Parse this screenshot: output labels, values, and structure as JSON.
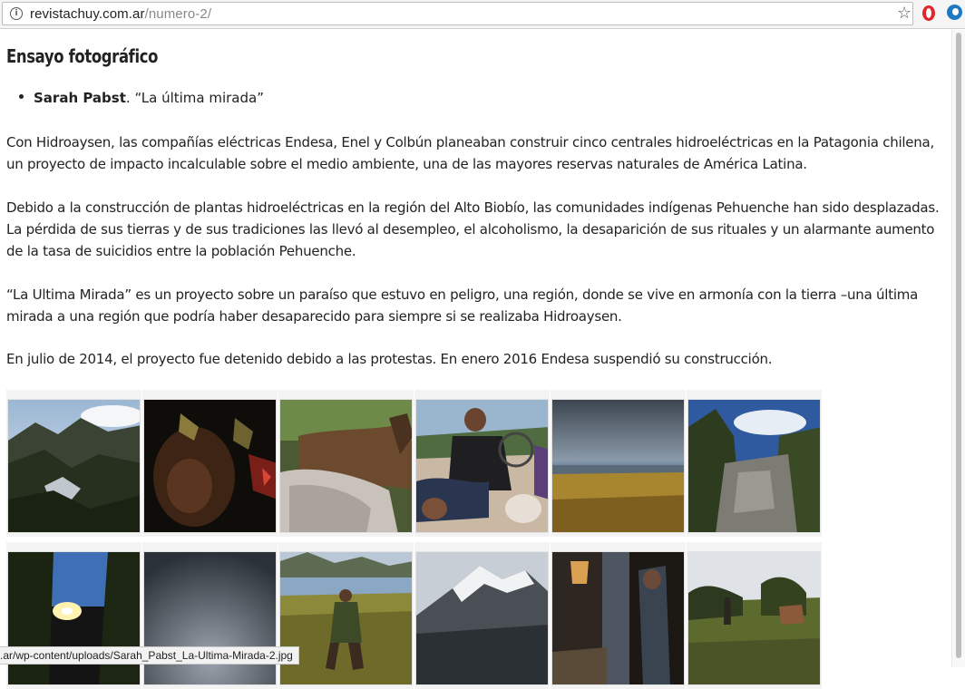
{
  "browser": {
    "url_domain": "revistachuy.com.ar",
    "url_path": "/numero-2/",
    "status_url": ".ar/wp-content/uploads/Sarah_Pabst_La-Ultima-Mirada-2.jpg"
  },
  "article": {
    "heading": "Ensayo fotográfico",
    "bullet_author": "Sarah Pabst",
    "bullet_title": ". “La última mirada”",
    "paragraphs": [
      "Con Hidroaysen, las compañías eléctricas Endesa, Enel y Colbún planeaban construir cinco centrales hidroeléctricas en la Patagonia chilena, un proyecto de impacto incalculable sobre el medio ambiente, una de las mayores reservas naturales de América Latina.",
      "Debido a la construcción de plantas hidroeléctricas en la región del Alto Biobío, las comunidades indígenas Pehuenche han sido desplazadas. La pérdida de sus tierras y de sus tradiciones las llevó al desempleo, el alcoholismo, la desaparición de sus rituales y un alarmante aumento de la tasa de suicidios entre la población Pehuenche.",
      "“La Ultima Mirada” es un proyecto sobre un paraíso que estuvo en peligro, una región, donde se vive en armonía con la tierra –una última mirada a una región que podría haber desaparecido para siempre si se realizaba Hidroaysen.",
      "En julio de 2014, el proyecto fue detenido debido a las protestas. En enero 2016 Endesa suspendió su construcción."
    ]
  },
  "gallery": {
    "row1": [
      "mountain-valley-landscape",
      "person-dark-portrait",
      "horses-closeup",
      "family-with-wheelchair",
      "golden-plain-cloudy-sky",
      "forest-rock-blue-sky"
    ],
    "row2": [
      "road-at-dusk-with-light",
      "dark-gray-sky",
      "person-in-wetland",
      "snowy-mountain",
      "kitchen-interior",
      "field-with-horse"
    ]
  }
}
